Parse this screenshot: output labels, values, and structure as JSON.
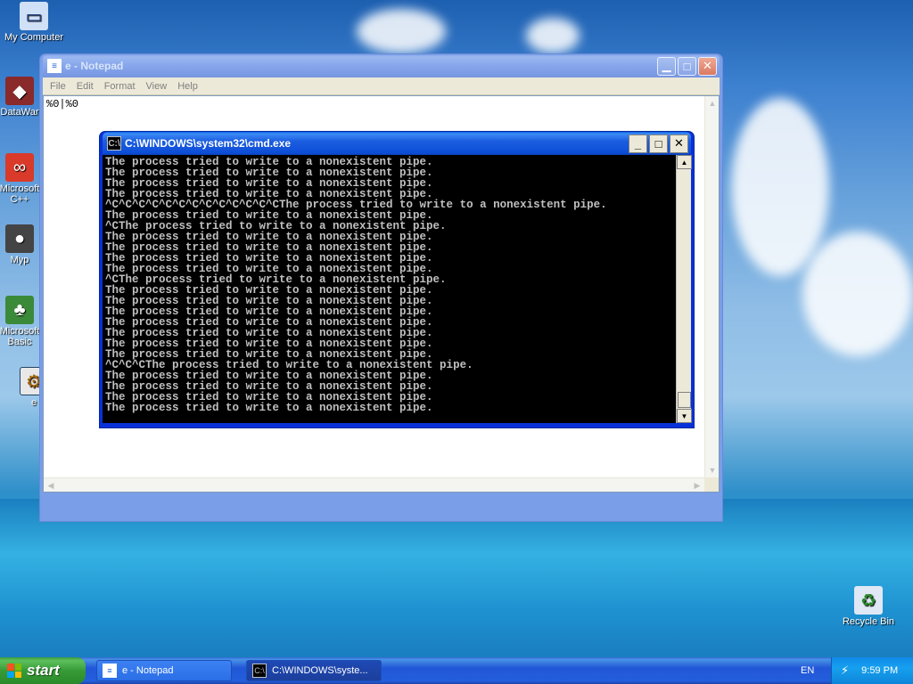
{
  "desktop": {
    "icons": [
      {
        "label": "My Computer"
      },
      {
        "label": "DataWar"
      },
      {
        "label": "Microsoft C++"
      },
      {
        "label": "Myp"
      },
      {
        "label": "Microsoft Basic"
      },
      {
        "label": "e"
      },
      {
        "label": "Recycle Bin"
      }
    ]
  },
  "notepad": {
    "title": "e - Notepad",
    "menu": [
      "File",
      "Edit",
      "Format",
      "View",
      "Help"
    ],
    "content": "%0|%0"
  },
  "cmd": {
    "title": "C:\\WINDOWS\\system32\\cmd.exe",
    "lines": [
      "The process tried to write to a nonexistent pipe.",
      "The process tried to write to a nonexistent pipe.",
      "The process tried to write to a nonexistent pipe.",
      "The process tried to write to a nonexistent pipe.",
      "^C^C^C^C^C^C^C^C^C^C^C^C^CThe process tried to write to a nonexistent pipe.",
      "The process tried to write to a nonexistent pipe.",
      "^CThe process tried to write to a nonexistent pipe.",
      "The process tried to write to a nonexistent pipe.",
      "The process tried to write to a nonexistent pipe.",
      "The process tried to write to a nonexistent pipe.",
      "The process tried to write to a nonexistent pipe.",
      "^CThe process tried to write to a nonexistent pipe.",
      "The process tried to write to a nonexistent pipe.",
      "The process tried to write to a nonexistent pipe.",
      "The process tried to write to a nonexistent pipe.",
      "The process tried to write to a nonexistent pipe.",
      "The process tried to write to a nonexistent pipe.",
      "The process tried to write to a nonexistent pipe.",
      "The process tried to write to a nonexistent pipe.",
      "^C^C^CThe process tried to write to a nonexistent pipe.",
      "The process tried to write to a nonexistent pipe.",
      "The process tried to write to a nonexistent pipe.",
      "The process tried to write to a nonexistent pipe.",
      "The process tried to write to a nonexistent pipe."
    ]
  },
  "taskbar": {
    "start_label": "start",
    "tasks": [
      {
        "label": "e - Notepad"
      },
      {
        "label": "C:\\WINDOWS\\syste..."
      }
    ],
    "language": "EN",
    "clock": "9:59 PM"
  }
}
